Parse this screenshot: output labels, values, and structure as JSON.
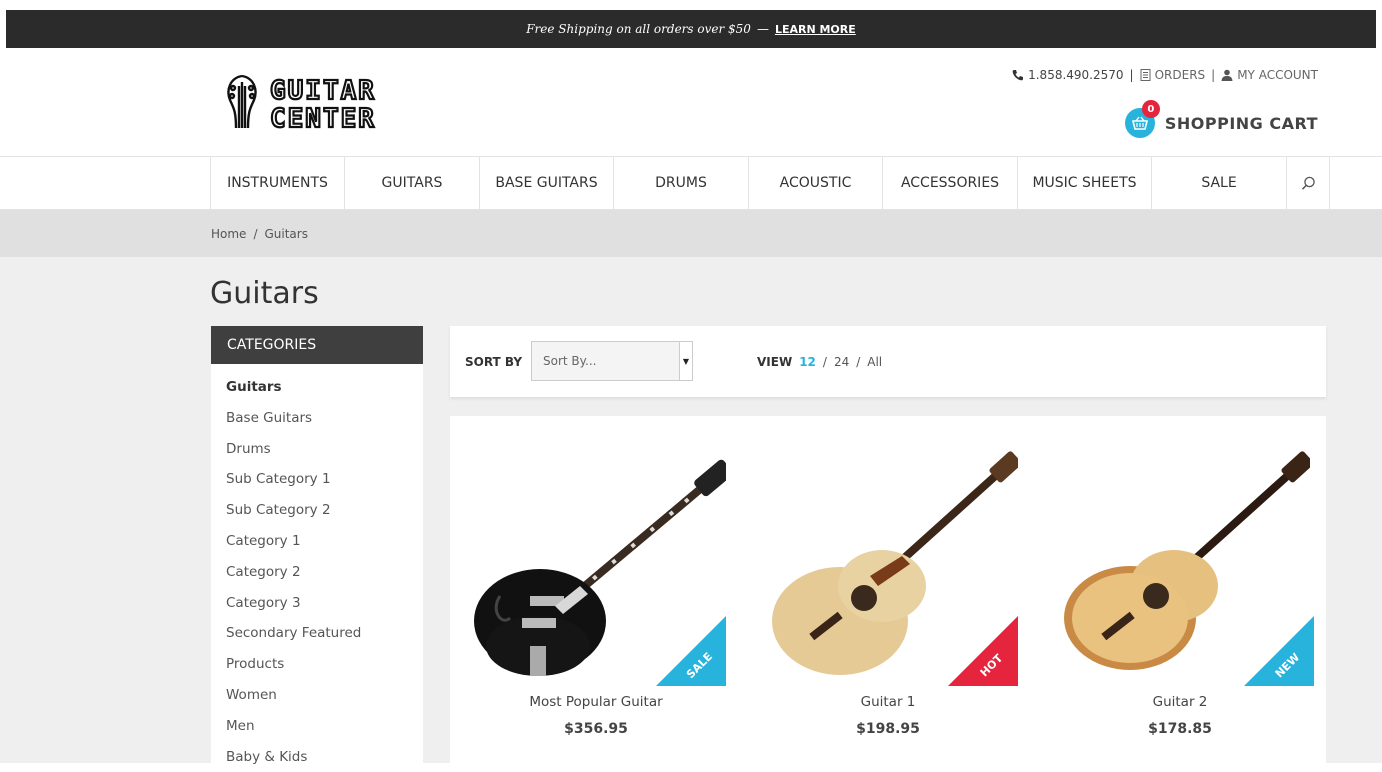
{
  "topbar": {
    "promo": "Free Shipping on all orders over $50",
    "separator": "—",
    "learn_more": "LEARN MORE"
  },
  "header": {
    "logo_top": "GUITAR",
    "logo_bottom": "CENTER",
    "phone": "1.858.490.2570",
    "orders": "ORDERS",
    "account": "MY ACCOUNT",
    "pipe": "|",
    "cart_label": "SHOPPING CART",
    "cart_count": "0"
  },
  "nav": {
    "items": [
      "INSTRUMENTS",
      "GUITARS",
      "BASE GUITARS",
      "DRUMS",
      "ACOUSTIC",
      "ACCESSORIES",
      "MUSIC SHEETS",
      "SALE"
    ]
  },
  "breadcrumb": {
    "home": "Home",
    "separator": "/",
    "current": "Guitars"
  },
  "page": {
    "title": "Guitars"
  },
  "sidebar": {
    "heading": "CATEGORIES",
    "items": [
      "Guitars",
      "Base Guitars",
      "Drums",
      "Sub Category 1",
      "Sub Category 2",
      "Category 1",
      "Category 2",
      "Category 3",
      "Secondary Featured",
      "Products",
      "Women",
      "Men",
      "Baby & Kids"
    ]
  },
  "toolbar": {
    "sort_label": "SORT BY",
    "sort_placeholder": "Sort By...",
    "view_label": "VIEW",
    "view_options": [
      "12",
      "24",
      "All"
    ],
    "view_separator": "/"
  },
  "products": [
    {
      "name": "Most Popular Guitar",
      "price": "$356.95",
      "badge": "SALE"
    },
    {
      "name": "Guitar 1",
      "price": "$198.95",
      "badge": "HOT"
    },
    {
      "name": "Guitar 2",
      "price": "$178.85",
      "badge": "NEW"
    }
  ],
  "colors": {
    "accent": "#27b3dc",
    "hot": "#e5243e",
    "topbar": "#2b2b2b",
    "category_header": "#3f3f3f"
  }
}
